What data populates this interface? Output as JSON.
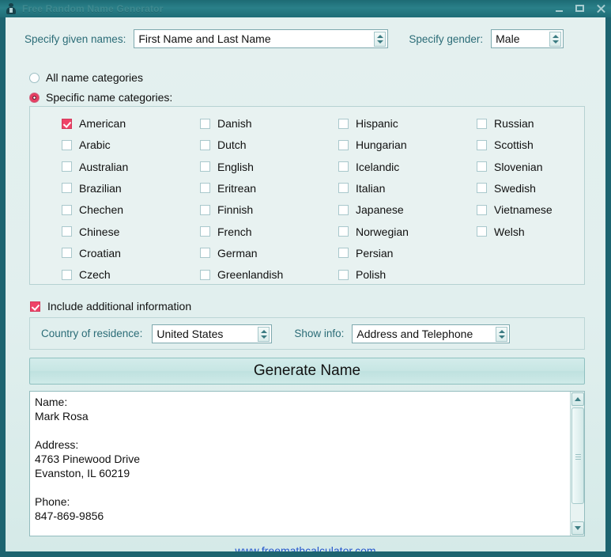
{
  "window": {
    "title": "Free Random Name Generator",
    "icon": "person-icon",
    "controls": {
      "minimize": "minimize-button",
      "maximize": "maximize-button",
      "close": "close-button"
    }
  },
  "top_row": {
    "given_names_label": "Specify given names:",
    "given_names_value": "First Name and Last Name",
    "gender_label": "Specify gender:",
    "gender_value": "Male"
  },
  "mode": {
    "all_label": "All name categories",
    "all_selected": false,
    "specific_label": "Specific name categories:",
    "specific_selected": true
  },
  "categories": {
    "columns": [
      [
        {
          "label": "American",
          "checked": true
        },
        {
          "label": "Arabic",
          "checked": false
        },
        {
          "label": "Australian",
          "checked": false
        },
        {
          "label": "Brazilian",
          "checked": false
        },
        {
          "label": "Chechen",
          "checked": false
        },
        {
          "label": "Chinese",
          "checked": false
        },
        {
          "label": "Croatian",
          "checked": false
        },
        {
          "label": "Czech",
          "checked": false
        }
      ],
      [
        {
          "label": "Danish",
          "checked": false
        },
        {
          "label": "Dutch",
          "checked": false
        },
        {
          "label": "English",
          "checked": false
        },
        {
          "label": "Eritrean",
          "checked": false
        },
        {
          "label": "Finnish",
          "checked": false
        },
        {
          "label": "French",
          "checked": false
        },
        {
          "label": "German",
          "checked": false
        },
        {
          "label": "Greenlandish",
          "checked": false
        }
      ],
      [
        {
          "label": "Hispanic",
          "checked": false
        },
        {
          "label": "Hungarian",
          "checked": false
        },
        {
          "label": "Icelandic",
          "checked": false
        },
        {
          "label": "Italian",
          "checked": false
        },
        {
          "label": "Japanese",
          "checked": false
        },
        {
          "label": "Norwegian",
          "checked": false
        },
        {
          "label": "Persian",
          "checked": false
        },
        {
          "label": "Polish",
          "checked": false
        }
      ],
      [
        {
          "label": "Russian",
          "checked": false
        },
        {
          "label": "Scottish",
          "checked": false
        },
        {
          "label": "Slovenian",
          "checked": false
        },
        {
          "label": "Swedish",
          "checked": false
        },
        {
          "label": "Vietnamese",
          "checked": false
        },
        {
          "label": "Welsh",
          "checked": false
        }
      ]
    ]
  },
  "additional": {
    "include_label": "Include additional information",
    "include_checked": true,
    "country_label": "Country of residence:",
    "country_value": "United States",
    "showinfo_label": "Show info:",
    "showinfo_value": "Address and Telephone"
  },
  "generate": {
    "label": "Generate Name"
  },
  "result": {
    "text": "Name:\nMark Rosa\n\nAddress:\n4763 Pinewood Drive\nEvanston, IL 60219\n\nPhone:\n847-869-9856"
  },
  "footer": {
    "link": "www.freemathcalculator.com"
  },
  "colors": {
    "titlebar": "#2a8089",
    "frame": "#1d6470",
    "client_bg": "#e1efee",
    "label": "#2b6c77",
    "accent_checked": "#ef4368",
    "link": "#2255cc"
  }
}
